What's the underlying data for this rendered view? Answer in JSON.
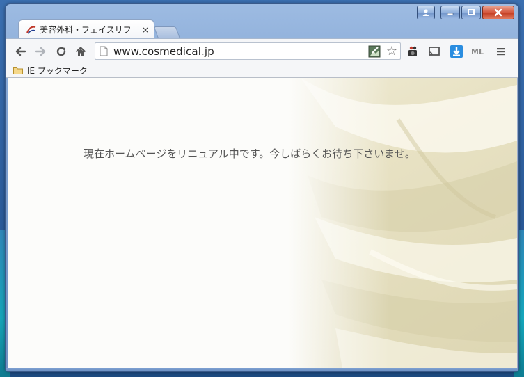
{
  "window": {
    "caption_buttons": [
      "profile",
      "minimize",
      "maximize",
      "close"
    ]
  },
  "tab": {
    "title": "美容外科・フェイスリフ",
    "close_glyph": "×"
  },
  "toolbar": {
    "back_glyph": "←",
    "forward_glyph": "→",
    "reload_glyph": "↻",
    "home_glyph": "⌂",
    "url": "www.cosmedical.jp",
    "star_glyph": "☆",
    "ml_label": "ML",
    "menu_glyph": "≡"
  },
  "bookmarks": {
    "items": [
      {
        "label": "IE ブックマーク",
        "icon": "folder-icon"
      }
    ]
  },
  "page": {
    "notice": "現在ホームページをリニュアル中です。今しばらくお待ち下さいませ。"
  },
  "colors": {
    "accent_close": "#c23a1f",
    "download_blue": "#2a8de0",
    "page_background": "#fcfcfa",
    "silk": "#e9e4c8"
  }
}
